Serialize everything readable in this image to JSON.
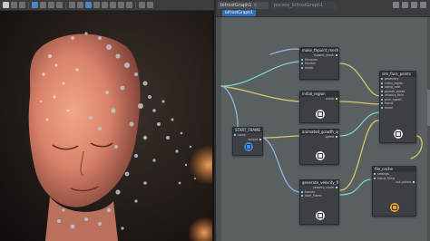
{
  "graph": {
    "tabs": [
      {
        "label": "bifrostGraph1"
      },
      {
        "label": "pocess_bifrostGraph1"
      }
    ],
    "active_graph": "bifrostGraph1"
  },
  "nodes": {
    "make_thpoint_mesh": {
      "title": "make_thpoint_mesh",
      "ports": [
        "thpoint_mesh",
        "filename",
        "fraction",
        "mode"
      ]
    },
    "initial_region": {
      "title": "initial_region",
      "ports": [
        "mesh"
      ]
    },
    "start_frame": {
      "title": "START_FRAME",
      "ports": [
        "value",
        "output"
      ]
    },
    "animated_growth_speed": {
      "title": "animated_growth_speed",
      "ports": [
        "speed"
      ]
    },
    "generate_velocity_field": {
      "title": "generate_velocity_field",
      "ports": [
        "velocity_curve",
        "frames",
        "start_frame"
      ]
    },
    "sim_face_points": {
      "title": "sim_face_points",
      "ports": [
        "geometry",
        "initial_region",
        "aging_rate",
        "growth_speed",
        "velocity_field",
        "prim_speed",
        "frame",
        "mode"
      ]
    },
    "file_cache": {
      "title": "file_cache",
      "ports": [
        "settings",
        "frame_filing",
        "out_points"
      ]
    }
  },
  "colors": {
    "accent": "#2f6fb8",
    "node_icon_orange": "#e6a52b",
    "node_icon_blue": "#3e90e0",
    "wire_teal": "#7ed3c4",
    "wire_yellow": "#d7c66b",
    "wire_blue": "#8fb7d9"
  },
  "icons": [
    "viewport-toolbar-icons",
    "graph-header-icons",
    "node-type-icons"
  ]
}
